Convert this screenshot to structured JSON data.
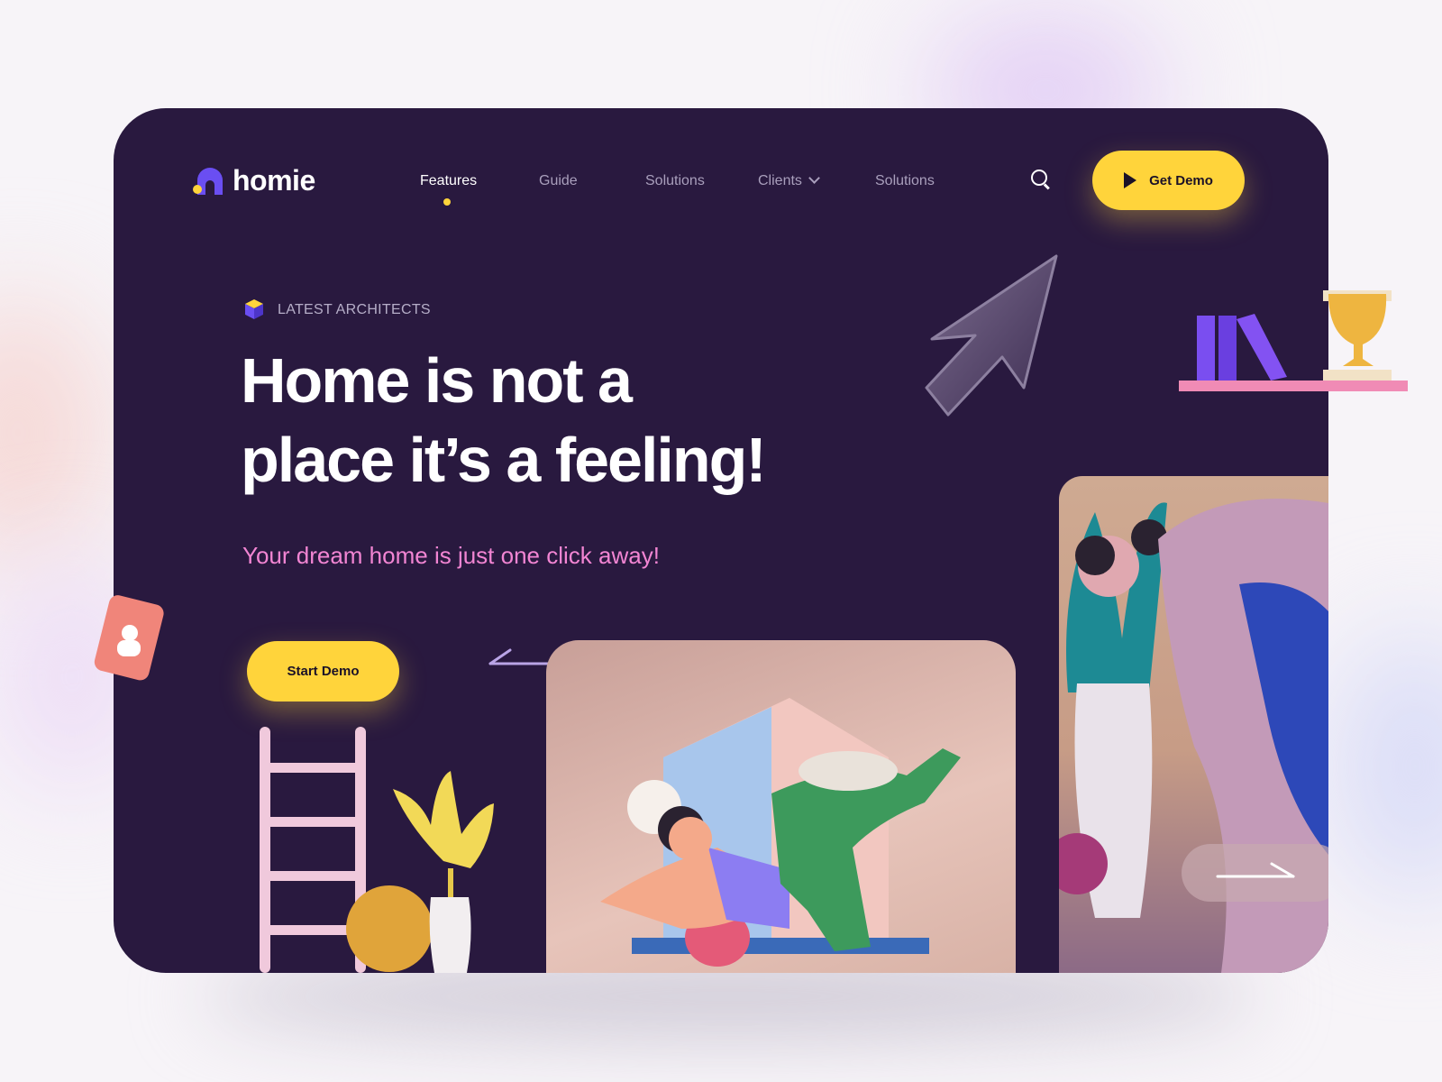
{
  "brand": {
    "name": "homie"
  },
  "nav": {
    "items": [
      {
        "label": "Features",
        "active": true
      },
      {
        "label": "Guide"
      },
      {
        "label": "Solutions"
      },
      {
        "label": "Clients",
        "has_dropdown": true
      },
      {
        "label": "Solutions"
      }
    ],
    "cta_label": "Get Demo"
  },
  "hero": {
    "eyebrow": "LATEST ARCHITECTS",
    "headline_line1": "Home is not a",
    "headline_line2": "place it’s a feeling!",
    "subtitle": "Your dream home is just one click away!",
    "cta_label": "Start Demo"
  },
  "icons": [
    "logo-mark-icon",
    "chevron-down-icon",
    "search-icon",
    "play-icon",
    "cube-icon",
    "arrow-left-icon",
    "arrow-right-icon",
    "cursor-icon",
    "trophy-icon"
  ],
  "colors": {
    "card_bg": "#29193f",
    "accent_yellow": "#ffd43b",
    "accent_purple": "#6a4ef2",
    "subtitle_pink": "#f285d3"
  }
}
